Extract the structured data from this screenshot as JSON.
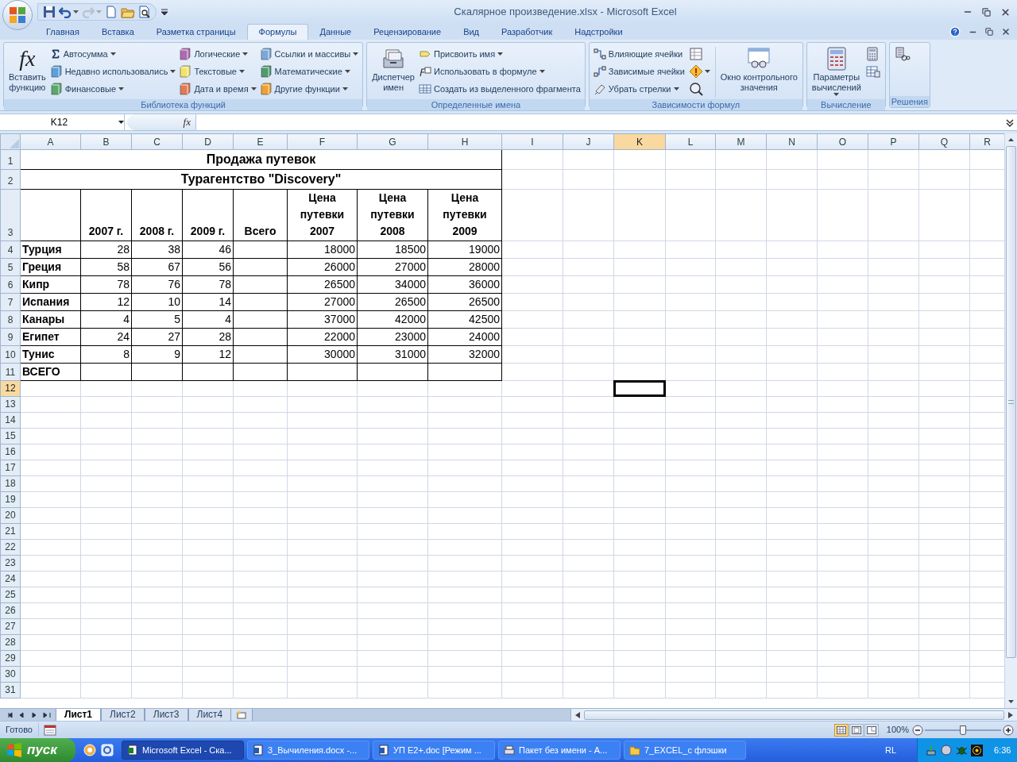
{
  "window": {
    "title": "Скалярное произведение.xlsx - Microsoft Excel"
  },
  "quick_access": [
    {
      "disabled": false,
      "dropdown": false
    },
    {
      "disabled": false,
      "dropdown": true
    },
    {
      "disabled": true,
      "dropdown": true
    },
    {
      "disabled": false,
      "dropdown": false
    },
    {
      "disabled": false,
      "dropdown": false
    },
    {
      "disabled": false,
      "dropdown": false
    }
  ],
  "ribbon_tabs": [
    {
      "label": "Главная",
      "selected": false
    },
    {
      "label": "Вставка",
      "selected": false
    },
    {
      "label": "Разметка страницы",
      "selected": false
    },
    {
      "label": "Формулы",
      "selected": true
    },
    {
      "label": "Данные",
      "selected": false
    },
    {
      "label": "Рецензирование",
      "selected": false
    },
    {
      "label": "Вид",
      "selected": false
    },
    {
      "label": "Разработчик",
      "selected": false
    },
    {
      "label": "Надстройки",
      "selected": false
    }
  ],
  "ribbon_groups": [
    {
      "title": "Библиотека функций",
      "columns": [
        {
          "kind": "large",
          "icon_text": "fx",
          "lines": [
            "Вставить",
            "функцию"
          ],
          "dropdown": false
        },
        {
          "kind": "small",
          "items": [
            {
              "label": "Автосумма",
              "dropdown": true
            },
            {
              "label": "Недавно использовались",
              "dropdown": true
            },
            {
              "label": "Финансовые",
              "dropdown": true
            }
          ]
        },
        {
          "kind": "small",
          "items": [
            {
              "label": "Логические",
              "dropdown": true
            },
            {
              "label": "Текстовые",
              "dropdown": true
            },
            {
              "label": "Дата и время",
              "dropdown": true
            }
          ]
        },
        {
          "kind": "small",
          "items": [
            {
              "label": "Ссылки и массивы",
              "dropdown": true
            },
            {
              "label": "Математические",
              "dropdown": true
            },
            {
              "label": "Другие функции",
              "dropdown": true
            }
          ]
        }
      ]
    },
    {
      "title": "Определенные имена",
      "columns": [
        {
          "kind": "large",
          "lines": [
            "Диспетчер",
            "имен"
          ],
          "dropdown": false
        },
        {
          "kind": "small",
          "items": [
            {
              "label": "Присвоить имя",
              "dropdown": true
            },
            {
              "label": "Использовать в формуле",
              "dropdown": true
            },
            {
              "label": "Создать из выделенного фрагмента",
              "dropdown": false
            }
          ]
        }
      ]
    },
    {
      "title": "Зависимости формул",
      "columns": [
        {
          "kind": "small",
          "items": [
            {
              "label": "Влияющие ячейки",
              "dropdown": false
            },
            {
              "label": "Зависимые ячейки",
              "dropdown": false
            },
            {
              "label": "Убрать стрелки",
              "dropdown": true
            }
          ]
        },
        {
          "kind": "icons",
          "items": [
            {
              "dropdown": false
            },
            {
              "dropdown": true
            },
            {
              "dropdown": false
            }
          ]
        },
        {
          "kind": "separator"
        },
        {
          "kind": "large",
          "lines": [
            "Окно контрольного",
            "значения"
          ],
          "dropdown": false
        }
      ]
    },
    {
      "title": "Вычисление",
      "columns": [
        {
          "kind": "large",
          "lines": [
            "Параметры",
            "вычислений"
          ],
          "dropdown": true
        },
        {
          "kind": "icons",
          "items": [
            {
              "dropdown": false
            },
            {
              "dropdown": false
            }
          ]
        }
      ]
    },
    {
      "title": "Решения",
      "columns": [
        {
          "kind": "icons",
          "items": [
            {
              "dropdown": false
            }
          ]
        }
      ]
    }
  ],
  "formula_bar": {
    "name_box": "K12",
    "function_button": "fx"
  },
  "sheet": {
    "columns": [
      {
        "label": "A",
        "selected": false
      },
      {
        "label": "B",
        "selected": false
      },
      {
        "label": "C",
        "selected": false
      },
      {
        "label": "D",
        "selected": false
      },
      {
        "label": "E",
        "selected": false
      },
      {
        "label": "F",
        "selected": false
      },
      {
        "label": "G",
        "selected": false
      },
      {
        "label": "H",
        "selected": false
      },
      {
        "label": "I",
        "selected": false
      },
      {
        "label": "J",
        "selected": false
      },
      {
        "label": "K",
        "selected": true
      },
      {
        "label": "L",
        "selected": false
      },
      {
        "label": "M",
        "selected": false
      },
      {
        "label": "N",
        "selected": false
      },
      {
        "label": "O",
        "selected": false
      },
      {
        "label": "P",
        "selected": false
      },
      {
        "label": "Q",
        "selected": false
      },
      {
        "label": "R",
        "selected": false
      }
    ],
    "rows": [
      {
        "label": "1",
        "selected": false
      },
      {
        "label": "2",
        "selected": false
      },
      {
        "label": "3",
        "selected": false
      },
      {
        "label": "4",
        "selected": false
      },
      {
        "label": "5",
        "selected": false
      },
      {
        "label": "6",
        "selected": false
      },
      {
        "label": "7",
        "selected": false
      },
      {
        "label": "8",
        "selected": false
      },
      {
        "label": "9",
        "selected": false
      },
      {
        "label": "10",
        "selected": false
      },
      {
        "label": "11",
        "selected": false
      },
      {
        "label": "12",
        "selected": true
      },
      {
        "label": "13",
        "selected": false
      },
      {
        "label": "14",
        "selected": false
      },
      {
        "label": "15",
        "selected": false
      },
      {
        "label": "16",
        "selected": false
      },
      {
        "label": "17",
        "selected": false
      },
      {
        "label": "18",
        "selected": false
      },
      {
        "label": "19",
        "selected": false
      },
      {
        "label": "20",
        "selected": false
      },
      {
        "label": "21",
        "selected": false
      },
      {
        "label": "22",
        "selected": false
      },
      {
        "label": "23",
        "selected": false
      },
      {
        "label": "24",
        "selected": false
      },
      {
        "label": "25",
        "selected": false
      },
      {
        "label": "26",
        "selected": false
      },
      {
        "label": "27",
        "selected": false
      },
      {
        "label": "28",
        "selected": false
      },
      {
        "label": "29",
        "selected": false
      },
      {
        "label": "30",
        "selected": false
      },
      {
        "label": "31",
        "selected": false
      }
    ],
    "table": {
      "title": "Продажа путевок",
      "subtitle": "Турагентство \"Discovery\"",
      "headers": [
        {
          "lines": [
            "2007 г."
          ]
        },
        {
          "lines": [
            "2008 г."
          ]
        },
        {
          "lines": [
            "2009 г."
          ]
        },
        {
          "lines": [
            "Всего"
          ]
        },
        {
          "lines": [
            "Цена",
            "путевки",
            "2007"
          ]
        },
        {
          "lines": [
            "Цена",
            "путевки",
            "2008"
          ]
        },
        {
          "lines": [
            "Цена",
            "путевки",
            "2009"
          ]
        }
      ],
      "rows": [
        {
          "label": "Турция",
          "sales": [
            "28",
            "38",
            "46"
          ],
          "prices": [
            "18000",
            "18500",
            "19000"
          ]
        },
        {
          "label": "Греция",
          "sales": [
            "58",
            "67",
            "56"
          ],
          "prices": [
            "26000",
            "27000",
            "28000"
          ]
        },
        {
          "label": "Кипр",
          "sales": [
            "78",
            "76",
            "78"
          ],
          "prices": [
            "26500",
            "34000",
            "36000"
          ]
        },
        {
          "label": "Испания",
          "sales": [
            "12",
            "10",
            "14"
          ],
          "prices": [
            "27000",
            "26500",
            "26500"
          ]
        },
        {
          "label": "Канары",
          "sales": [
            "4",
            "5",
            "4"
          ],
          "prices": [
            "37000",
            "42000",
            "42500"
          ]
        },
        {
          "label": "Египет",
          "sales": [
            "24",
            "27",
            "28"
          ],
          "prices": [
            "22000",
            "23000",
            "24000"
          ]
        },
        {
          "label": "Тунис",
          "sales": [
            "8",
            "9",
            "12"
          ],
          "prices": [
            "30000",
            "31000",
            "32000"
          ]
        },
        {
          "label": "ВСЕГО"
        }
      ]
    }
  },
  "sheet_tabs": [
    {
      "label": "Лист1",
      "selected": true
    },
    {
      "label": "Лист2",
      "selected": false
    },
    {
      "label": "Лист3",
      "selected": false
    },
    {
      "label": "Лист4",
      "selected": false
    }
  ],
  "status_bar": {
    "status": "Готово",
    "views": [
      {
        "selected": true
      },
      {
        "selected": false
      },
      {
        "selected": false
      }
    ],
    "zoom": "100%",
    "zoom_slider": {
      "level": 0.5
    }
  },
  "taskbar": {
    "start": "пуск",
    "tasks": [
      {
        "label": "Microsoft Excel - Ска...",
        "selected": true
      },
      {
        "label": "3_Вычиления.docx -...",
        "selected": false
      },
      {
        "label": "УП E2+.doc [Режим ...",
        "selected": false
      },
      {
        "label": "Пакет без имени - А...",
        "selected": false
      },
      {
        "label": "7_EXCEL_с флэшки",
        "selected": false
      }
    ],
    "language": "RL",
    "clock": "6:36"
  }
}
